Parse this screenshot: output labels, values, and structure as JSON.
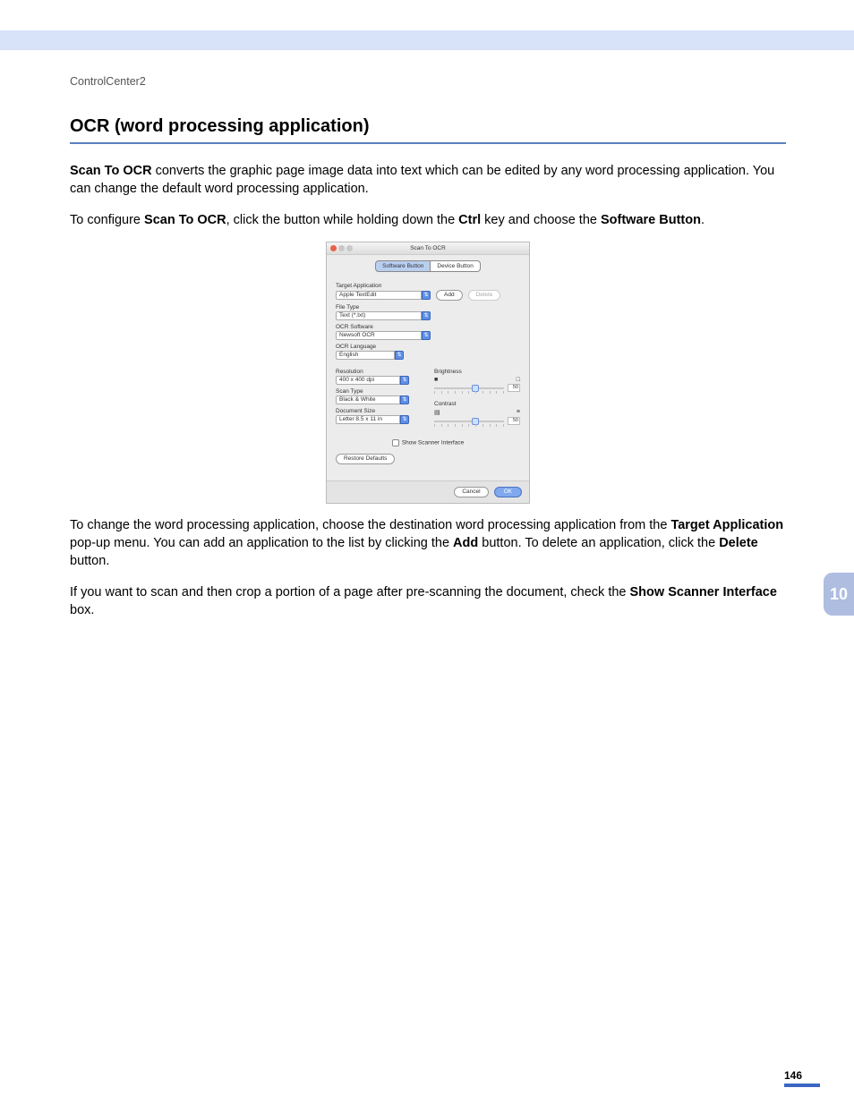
{
  "header": {
    "breadcrumb": "ControlCenter2"
  },
  "chapter_tab": "10",
  "page_number": "146",
  "title": "OCR (word processing application)",
  "p1": {
    "b1": "Scan To OCR",
    "t1": " converts the graphic page image data into text which can be edited by any word processing application. You can change the default word processing application."
  },
  "p2": {
    "t1": "To configure ",
    "b1": "Scan To OCR",
    "t2": ", click the button while holding down the ",
    "b2": "Ctrl",
    "t3": " key and choose the ",
    "b3": "Software Button",
    "t4": "."
  },
  "p3": {
    "t1": "To change the word processing application, choose the destination word processing application from the ",
    "b1": "Target Application",
    "t2": " pop-up menu. You can add an application to the list by clicking the ",
    "b2": "Add",
    "t3": " button. To delete an application, click the ",
    "b3": "Delete",
    "t4": " button."
  },
  "p4": {
    "t1": "If you want to scan and then crop a portion of a page after pre-scanning the document, check the ",
    "b1": "Show Scanner Interface",
    "t2": " box."
  },
  "dialog": {
    "title": "Scan To OCR",
    "tabs": {
      "active": "Software Button",
      "other": "Device Button"
    },
    "labels": {
      "target_app": "Target Application",
      "file_type": "File Type",
      "ocr_software": "OCR Software",
      "ocr_language": "OCR Language",
      "resolution": "Resolution",
      "scan_type": "Scan Type",
      "doc_size": "Document Size",
      "brightness": "Brightness",
      "contrast": "Contrast",
      "show_scanner": "Show Scanner Interface"
    },
    "values": {
      "target_app": "Apple TextEdit",
      "file_type": "Text (*.txt)",
      "ocr_software": "Newsoft OCR",
      "ocr_language": "English",
      "resolution": "400 x 400 dpi",
      "scan_type": "Black & White",
      "doc_size": "Letter 8.5 x 11 in",
      "brightness": "50",
      "contrast": "50"
    },
    "buttons": {
      "add": "Add",
      "delete": "Delete",
      "restore": "Restore Defaults",
      "cancel": "Cancel",
      "ok": "OK"
    }
  }
}
